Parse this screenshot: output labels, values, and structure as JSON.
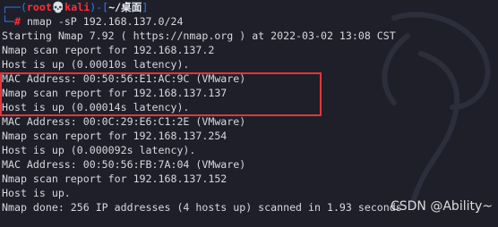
{
  "prompt": {
    "corner_top": "┌──(",
    "user": "root",
    "skull": "💀",
    "host": "kali",
    "sep": ")-[",
    "path": "~/桌面",
    "close": "]",
    "corner_bottom": "└─",
    "hash": "#",
    "command": "nmap -sP 192.168.137.0/24"
  },
  "output_lines": [
    "Starting Nmap 7.92 ( https://nmap.org ) at 2022-03-02 13:08 CST",
    "Nmap scan report for 192.168.137.2",
    "Host is up (0.00010s latency).",
    "MAC Address: 00:50:56:E1:AC:9C (VMware)",
    "Nmap scan report for 192.168.137.137",
    "Host is up (0.00014s latency).",
    "MAC Address: 00:0C:29:E6:C1:2E (VMware)",
    "Nmap scan report for 192.168.137.254",
    "Host is up (0.000092s latency).",
    "MAC Address: 00:50:56:FB:7A:04 (VMware)",
    "Nmap scan report for 192.168.137.152",
    "Host is up.",
    "Nmap done: 256 IP addresses (4 hosts up) scanned in 1.93 seconds"
  ],
  "watermark": "CSDN @Ability~",
  "colors": {
    "background": "#1e1f29",
    "prompt_blue": "#2f7bf2",
    "prompt_red": "#ff2e3a",
    "highlight_box": "#e3363b",
    "text": "#d6d8de"
  }
}
